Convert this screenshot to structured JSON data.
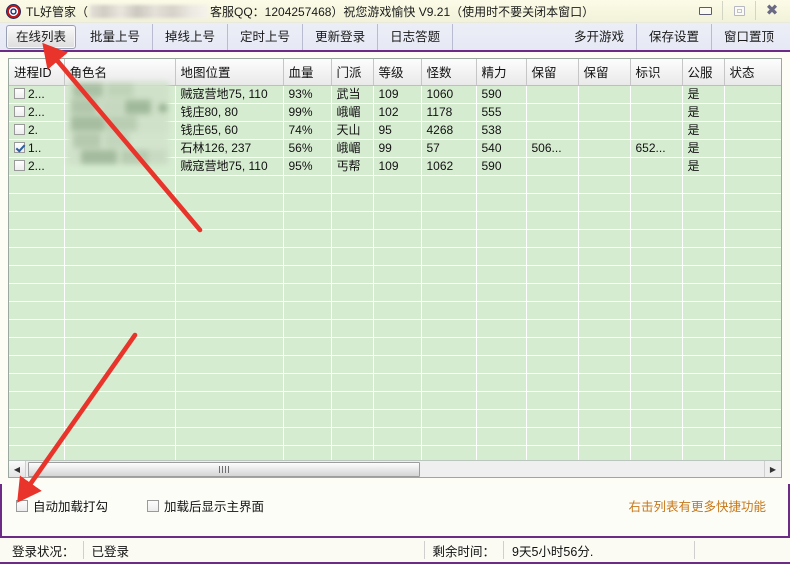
{
  "window": {
    "app_icon": "app-logo-icon",
    "title_prefix": "TL好管家（",
    "title_redacted": "",
    "title_suffix": "客服QQ：1204257468）祝您游戏愉快 V9.21（使用时不要关闭本窗口）",
    "buttons": {
      "minimize": "minimize-icon",
      "maximize": "maximize-icon",
      "close": "close-icon"
    }
  },
  "toolbar": {
    "left_items": [
      {
        "label": "在线列表",
        "active": true
      },
      {
        "label": "批量上号",
        "active": false
      },
      {
        "label": "掉线上号",
        "active": false
      },
      {
        "label": "定时上号",
        "active": false
      },
      {
        "label": "更新登录",
        "active": false
      },
      {
        "label": "日志答题",
        "active": false
      }
    ],
    "right_items": [
      {
        "label": "多开游戏"
      },
      {
        "label": "保存设置"
      },
      {
        "label": "窗口置顶"
      }
    ]
  },
  "grid": {
    "columns": [
      "进程ID",
      "角色名",
      "地图位置",
      "血量",
      "门派",
      "等级",
      "怪数",
      "精力",
      "保留",
      "保留",
      "标识",
      "公服",
      "状态"
    ],
    "rows": [
      {
        "checked": false,
        "pid": "2...",
        "name": "",
        "map": "贼寇营地75, 110",
        "hp": "93%",
        "sect": "武当",
        "level": "109",
        "monsters": "1060",
        "energy": "590",
        "reserve1": "",
        "reserve2": "",
        "flag": "",
        "public": "是",
        "status": ""
      },
      {
        "checked": false,
        "pid": "2...",
        "name": "",
        "map": "钱庄80, 80",
        "hp": "99%",
        "sect": "峨嵋",
        "level": "102",
        "monsters": "1178",
        "energy": "555",
        "reserve1": "",
        "reserve2": "",
        "flag": "",
        "public": "是",
        "status": ""
      },
      {
        "checked": false,
        "pid": "2.",
        "name": "",
        "map": "钱庄65, 60",
        "hp": "74%",
        "sect": "天山",
        "level": "95",
        "monsters": "4268",
        "energy": "538",
        "reserve1": "",
        "reserve2": "",
        "flag": "",
        "public": "是",
        "status": ""
      },
      {
        "checked": true,
        "pid": "1..",
        "name": "",
        "map": "石林126, 237",
        "hp": "56%",
        "sect": "峨嵋",
        "level": "99",
        "monsters": "57",
        "energy": "540",
        "reserve1": "506...",
        "reserve2": "",
        "flag": "652...",
        "public": "是",
        "status": ""
      },
      {
        "checked": false,
        "pid": "2...",
        "name": "",
        "map": "贼寇营地75, 110",
        "hp": "95%",
        "sect": "丐帮",
        "level": "109",
        "monsters": "1062",
        "energy": "590",
        "reserve1": "",
        "reserve2": "",
        "flag": "",
        "public": "是",
        "status": ""
      }
    ],
    "empty_row_count": 19,
    "scrollbar": {
      "left_arrow": "scroll-left-icon",
      "right_arrow": "scroll-right-icon"
    }
  },
  "options": {
    "auto_load_check": "自动加载打勾",
    "show_main_after_load": "加载后显示主界面",
    "hint": "右击列表有更多快捷功能",
    "hint_color": "#c6781a"
  },
  "statusbar": {
    "login_label": "登录状况：",
    "login_value": "已登录",
    "time_label": "剩余时间：",
    "time_value": "9天5小时56分."
  },
  "annotations": {
    "arrow_color": "#e8342a",
    "arrow1_target": "在线列表",
    "arrow2_target": "自动加载打勾"
  },
  "theme": {
    "accent_purple": "#6c2b84",
    "grid_row_green": "#d6ecd1",
    "title_gradient_top": "#fbfbe8",
    "toolbar_bg": "#eceef7"
  }
}
